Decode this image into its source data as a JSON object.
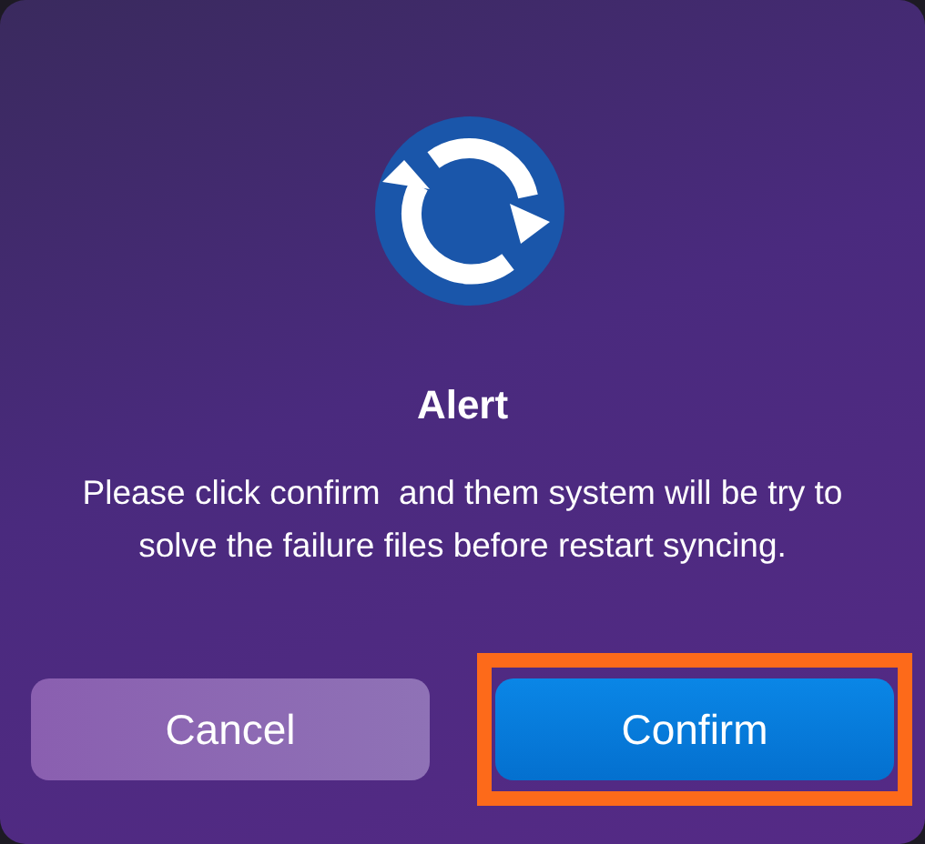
{
  "dialog": {
    "title": "Alert",
    "message": "Please click confirm  and them system will be try to solve the failure files before restart syncing."
  },
  "buttons": [
    {
      "label": "Cancel",
      "kind": "secondary",
      "highlighted": false
    },
    {
      "label": "Confirm",
      "kind": "primary",
      "highlighted": true
    }
  ]
}
